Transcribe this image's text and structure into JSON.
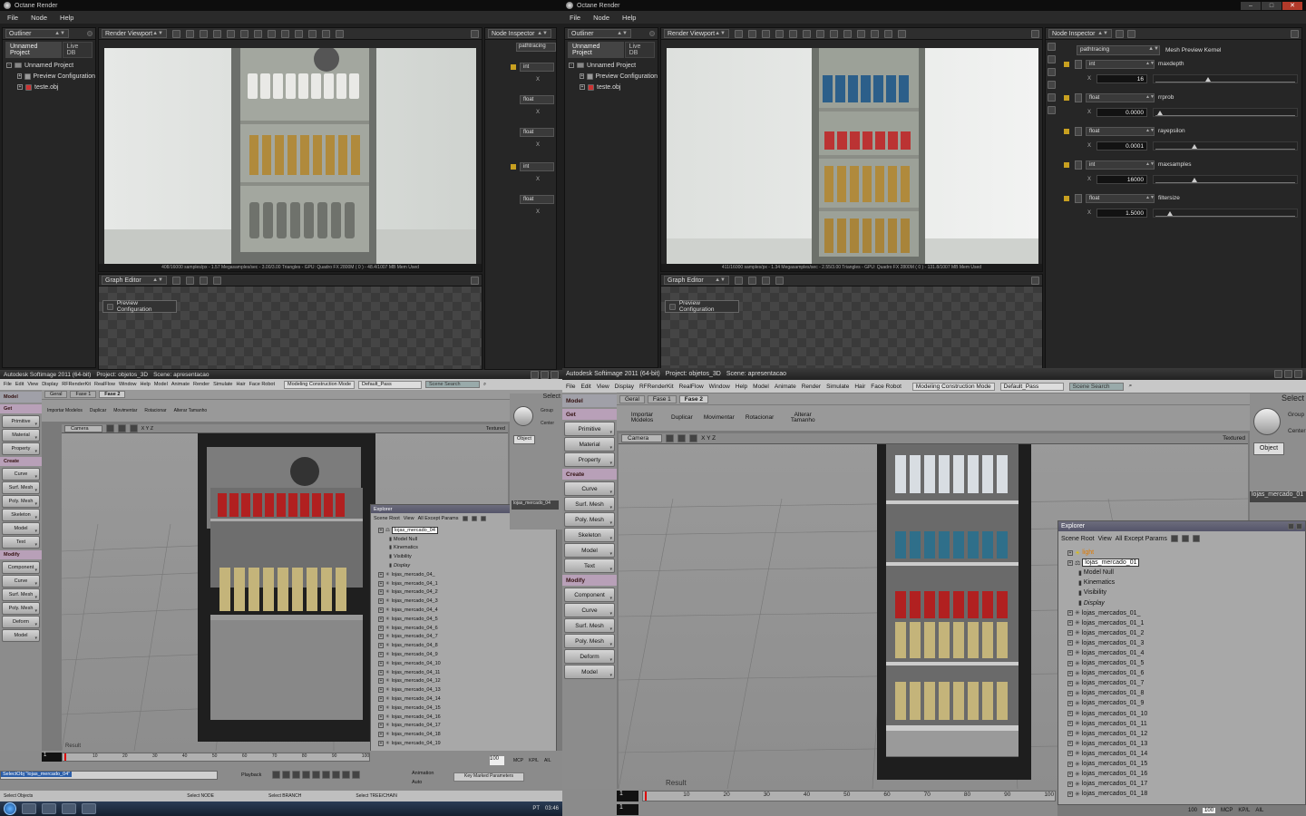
{
  "octane": {
    "title": "Octane Render",
    "menu": [
      "File",
      "Node",
      "Help"
    ],
    "outliner": {
      "label": "Outliner",
      "tabs": [
        "Unnamed Project",
        "Live DB"
      ],
      "tree": [
        "Unnamed Project",
        "Preview Configuration",
        "teste.obj"
      ]
    },
    "render_viewport_label": "Render Viewport",
    "graph_editor_label": "Graph Editor",
    "node_label": "Preview Configuration",
    "node_inspector_label": "Node Inspector",
    "left": {
      "status": "408/16000 samples/px - 1.57 Megasamples/sec - 3.00/3.00 Triangles - GPU: Quadro FX 2800M ( 0 ) - 48.4/1007 MB Mem Used",
      "inspector_short": "pathtracing",
      "params": [
        {
          "type": "int",
          "x": "X"
        },
        {
          "type": "float",
          "x": "X"
        },
        {
          "type": "float",
          "x": "X"
        },
        {
          "type": "int",
          "x": "X"
        },
        {
          "type": "float",
          "x": "X"
        }
      ]
    },
    "right": {
      "status": "411/16000 samples/px - 1.34 Megasamples/sec - 2.55/3.00 Triangles - GPU: Quadro FX 2800M ( 0 ) - 131.8/1007 MB Mem Used",
      "inspector_kernel": "pathtracing",
      "inspector_kernel_label": "Mesh Preview Kernel",
      "params": [
        {
          "type": "int",
          "name": "maxdepth",
          "x": "X",
          "value": "16",
          "pos": 0.35
        },
        {
          "type": "float",
          "name": "rrprob",
          "x": "X",
          "value": "0.0000",
          "pos": 0.0
        },
        {
          "type": "float",
          "name": "rayepsilon",
          "x": "X",
          "value": "0.0001",
          "pos": 0.25
        },
        {
          "type": "int",
          "name": "maxsamples",
          "x": "X",
          "value": "16000",
          "pos": 0.25
        },
        {
          "type": "float",
          "name": "filtersize",
          "x": "X",
          "value": "1.5000",
          "pos": 0.07
        }
      ]
    }
  },
  "softimage": {
    "left": {
      "title": "Autodesk Softimage 2011 (64-bit)",
      "project": "Project: objetos_3D",
      "scene": "Scene: apresentacao",
      "mode": "Modeling Construction Mode",
      "pass": "Default_Pass",
      "search_placeholder": "Scene Search",
      "selection_text": "SelectObj \"lojas_mercado_04\"",
      "status_items": [
        "Select Objects",
        "Select NODE",
        "Select BRANCH",
        "Select TREE/CHAIN"
      ],
      "lang": "PT",
      "clock": "03:46",
      "explorer_root": "lojas_mercado_04",
      "explorer_children": [
        "lojas_mercado_04_",
        "lojas_mercado_04_1",
        "lojas_mercado_04_2",
        "lojas_mercado_04_3",
        "lojas_mercado_04_4",
        "lojas_mercado_04_5",
        "lojas_mercado_04_6",
        "lojas_mercado_04_7",
        "lojas_mercado_04_8",
        "lojas_mercado_04_9",
        "lojas_mercado_04_10",
        "lojas_mercado_04_11",
        "lojas_mercado_04_12",
        "lojas_mercado_04_13",
        "lojas_mercado_04_14",
        "lojas_mercado_04_15",
        "lojas_mercado_04_16",
        "lojas_mercado_04_17",
        "lojas_mercado_04_18",
        "lojas_mercado_04_19"
      ],
      "prop_name": "lojas_mercado_04",
      "playback": "Playback",
      "animation": "Animation",
      "auto": "Auto",
      "key_params": "Key Marked Parameters"
    },
    "right": {
      "title": "Autodesk Softimage 2011 (64-bit)",
      "project": "Project: objetos_3D",
      "scene": "Scene: apresentacao",
      "mode": "Modeling Construction Mode",
      "pass": "Default_Pass",
      "search_placeholder": "Scene Search",
      "explorer_light": "light",
      "explorer_root": "lojas_mercado_01",
      "explorer_children": [
        "lojas_mercados_01_",
        "lojas_mercados_01_1",
        "lojas_mercados_01_2",
        "lojas_mercados_01_3",
        "lojas_mercados_01_4",
        "lojas_mercados_01_5",
        "lojas_mercados_01_6",
        "lojas_mercados_01_7",
        "lojas_mercados_01_8",
        "lojas_mercados_01_9",
        "lojas_mercados_01_10",
        "lojas_mercados_01_11",
        "lojas_mercados_01_12",
        "lojas_mercados_01_13",
        "lojas_mercados_01_14",
        "lojas_mercados_01_15",
        "lojas_mercados_01_16",
        "lojas_mercados_01_17",
        "lojas_mercados_01_18"
      ],
      "prop_name": "lojas_mercado_01"
    },
    "menu": [
      "File",
      "Edit",
      "View",
      "Display",
      "RFRenderKit",
      "RealFlow",
      "Window",
      "Help",
      "Model",
      "Animate",
      "Render",
      "Simulate",
      "Hair",
      "Face Robot"
    ],
    "model_label": "Model",
    "left_panel": {
      "get": "Get",
      "get_items": [
        "Primitive",
        "Material",
        "Property"
      ],
      "create": "Create",
      "create_items": [
        "Curve",
        "Surf. Mesh",
        "Poly. Mesh",
        "Skeleton",
        "Model",
        "Text"
      ],
      "modify": "Modify",
      "modify_items": [
        "Component",
        "Curve",
        "Surf. Mesh",
        "Poly. Mesh",
        "Deform",
        "Model"
      ]
    },
    "tabs": [
      "Geral",
      "Fase 1",
      "Fase 2"
    ],
    "actions": [
      "Importar Modelos",
      "Duplicar",
      "Movimentar",
      "Rotacionar",
      "Alterar Tamanho"
    ],
    "camera_label": "Camera",
    "xyz": "X Y Z",
    "textured": "Textured",
    "result": "Result",
    "explorer": {
      "title": "Explorer",
      "scene_root": "Scene Root",
      "view": "View",
      "filter": "All Except Params",
      "model_null": "Model Null",
      "kinematics": "Kinematics",
      "visibility": "Visibility",
      "display": "Display"
    },
    "right_prop": {
      "select": "Select",
      "group": "Group",
      "center": "Center",
      "object": "Object"
    },
    "timeline": {
      "start": "1",
      "end": "100",
      "ticks": [
        "10",
        "20",
        "30",
        "40",
        "50",
        "60",
        "70",
        "80",
        "90",
        "100"
      ],
      "frame_end": "100",
      "mcp": "MCP",
      "kpl": "KP/L",
      "ail": "AIL"
    }
  },
  "colors": {
    "octane_bg": "#1e1e1e",
    "softimage_bg": "#8d8d8d",
    "explorer_header": "#5f5f74",
    "selection": "#2a5da8"
  }
}
